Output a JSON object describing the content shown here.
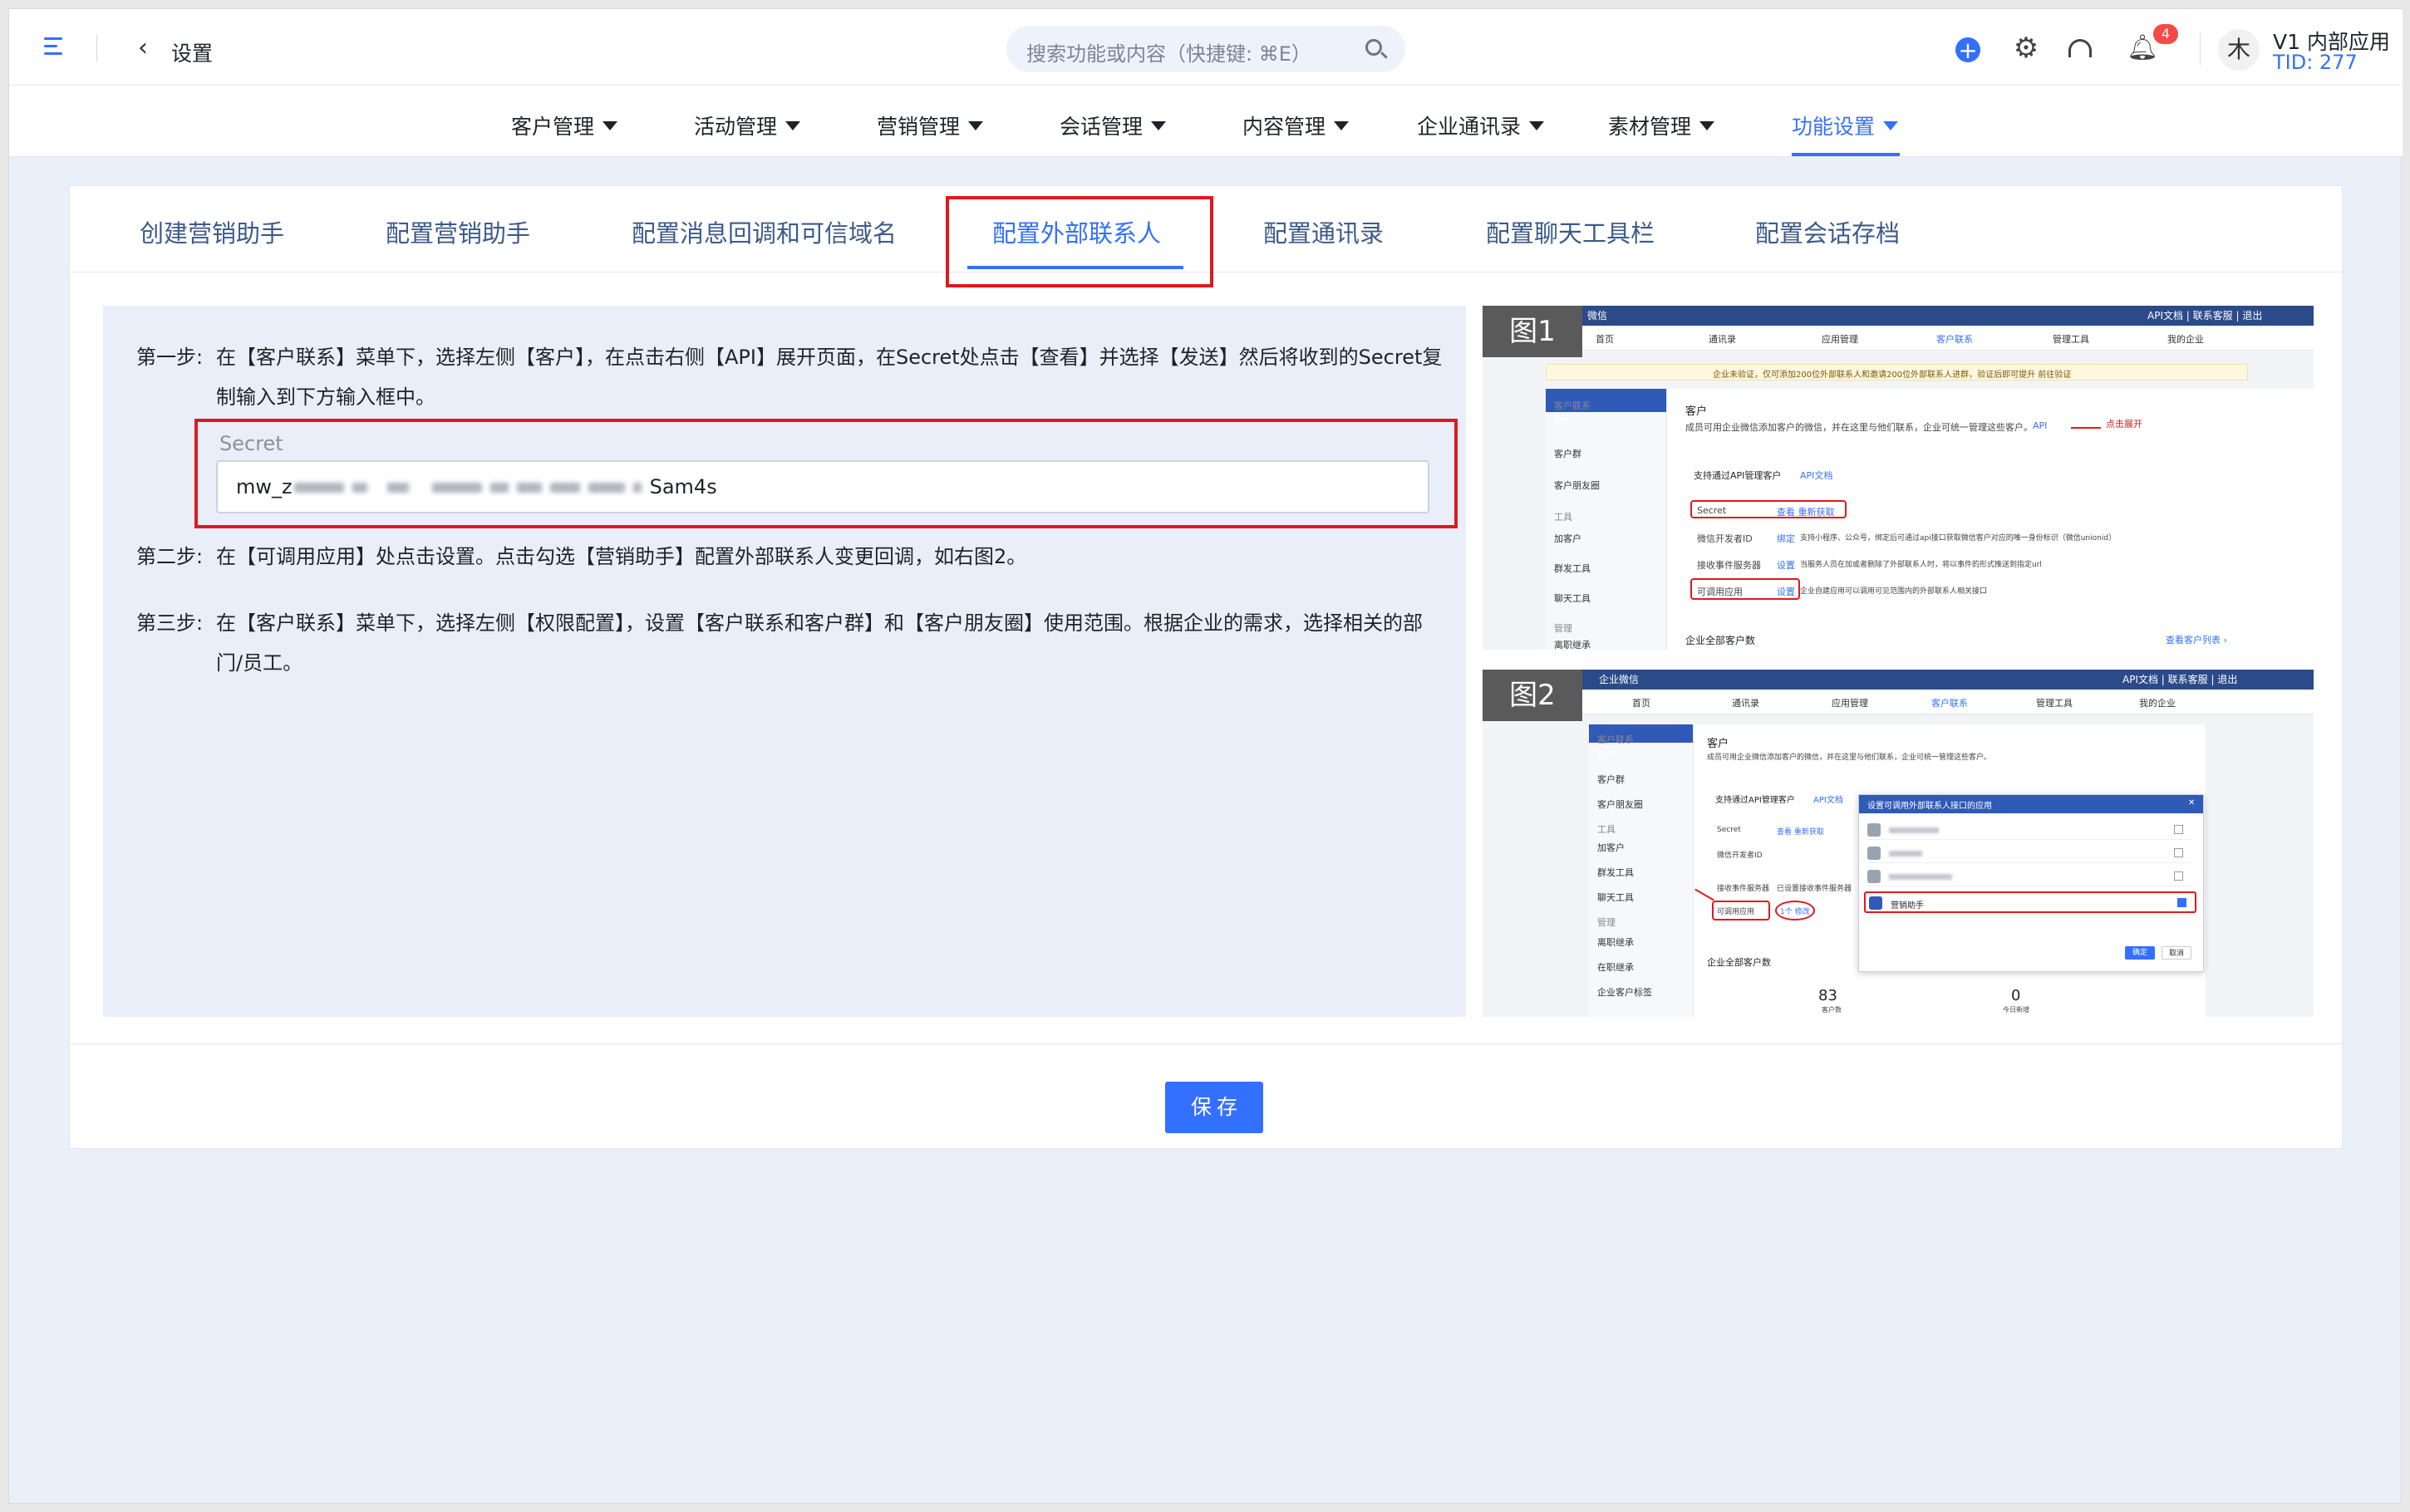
{
  "topbar": {
    "page_title": "设置",
    "search_placeholder": "搜索功能或内容（快捷键: ⌘E）",
    "notification_count": "4",
    "avatar_text": "木",
    "tenant_name": "V1 内部应用",
    "tenant_tid": "TID: 277"
  },
  "nav": {
    "items": [
      "客户管理",
      "活动管理",
      "营销管理",
      "会话管理",
      "内容管理",
      "企业通讯录",
      "素材管理",
      "功能设置"
    ],
    "active_index": 7
  },
  "tabs": {
    "items": [
      "创建营销助手",
      "配置营销助手",
      "配置消息回调和可信域名",
      "配置外部联系人",
      "配置通讯录",
      "配置聊天工具栏",
      "配置会话存档"
    ],
    "active_index": 3
  },
  "steps": {
    "step1_label": "第一步:",
    "step1_text": "在【客户联系】菜单下，选择左侧【客户】，在点击右侧【API】展开页面，在Secret处点击【查看】并选择【发送】然后将收到的Secret复制输入到下方输入框中。",
    "secret_label": "Secret",
    "secret_prefix": "mw_z",
    "secret_suffix": "Sam4s",
    "step2_label": "第二步:",
    "step2_text": "在【可调用应用】处点击设置。点击勾选【营销助手】配置外部联系人变更回调，如右图2。",
    "step3_label": "第三步:",
    "step3_text": "在【客户联系】菜单下，选择左侧【权限配置】，设置【客户联系和客户群】和【客户朋友圈】使用范围。根据企业的需求，选择相关的部门/员工。"
  },
  "figure1": {
    "tag": "图1",
    "header_left": "微信",
    "header_right": "API文档 | 联系客服 | 退出",
    "subnav": [
      "首页",
      "通讯录",
      "应用管理",
      "客户联系",
      "管理工具",
      "我的企业"
    ],
    "notice": "企业未验证，仅可添加200位外部联系人和邀请200位外部联系人进群，验证后即可提升 前往验证",
    "sidebar": [
      "客户联系",
      "客户",
      "客户群",
      "客户朋友圈",
      "工具",
      "加客户",
      "群发工具",
      "聊天工具",
      "管理",
      "离职继承"
    ],
    "title": "客户",
    "desc": "成员可用企业微信添加客户的微信，并在这里与他们联系，企业可统一管理这些客户。",
    "api_tag": "API",
    "click_expand": "点击展开",
    "api_section": "支持通过API管理客户",
    "api_doc": "API文档",
    "secret_row": "Secret",
    "secret_actions": "查看  重新获取",
    "devid_row": "微信开发者ID",
    "devid_action": "绑定",
    "devid_desc": "支持小程序、公众号，绑定后可通过api接口获取微信客户对应的唯一身份标识（微信unionid）",
    "event_row": "接收事件服务器",
    "event_action": "设置",
    "event_desc": "当服务人员在加或者删除了外部联系人时，将以事件的形式推送到指定url",
    "app_row": "可调用应用",
    "app_action": "设置",
    "app_desc": "企业自建应用可以调用可见范围内的外部联系人相关接口",
    "all_customers": "企业全部客户数",
    "view_list": "查看客户列表 ›"
  },
  "figure2": {
    "tag": "图2",
    "header_left": "企业微信",
    "header_right": "API文档 | 联系客服 | 退出",
    "subnav": [
      "首页",
      "通讯录",
      "应用管理",
      "客户联系",
      "管理工具",
      "我的企业"
    ],
    "sidebar": [
      "客户联系",
      "客户",
      "客户群",
      "客户朋友圈",
      "工具",
      "加客户",
      "群发工具",
      "聊天工具",
      "管理",
      "离职继承",
      "在职继承",
      "企业客户标签"
    ],
    "title": "客户",
    "desc": "成员可用企业微信添加客户的微信，并在这里与他们联系，企业可统一管理这些客户。",
    "api_section": "支持通过API管理客户",
    "api_doc": "API文档",
    "secret_row": "Secret",
    "secret_actions": "查看  重新获取",
    "devid_row": "微信开发者ID",
    "event_row": "接收事件服务器",
    "event_value": "已设置接收事件服务器",
    "app_row": "可调用应用",
    "app_value": "1个 修改",
    "all_customers": "企业全部客户数",
    "stat1_value": "83",
    "stat1_label": "客户数",
    "stat2_value": "0",
    "stat2_label": "今日新增",
    "dialog_title": "设置可调用外部联系人接口的应用",
    "dialog_close": "✕",
    "dialog_checked_item": "营销助手",
    "dialog_confirm": "确定",
    "dialog_cancel": "取消"
  },
  "footer": {
    "save_label": "保存"
  },
  "colors": {
    "primary": "#3370ff",
    "highlight_red": "#e0191e",
    "panel_bg": "#e9eef8"
  }
}
